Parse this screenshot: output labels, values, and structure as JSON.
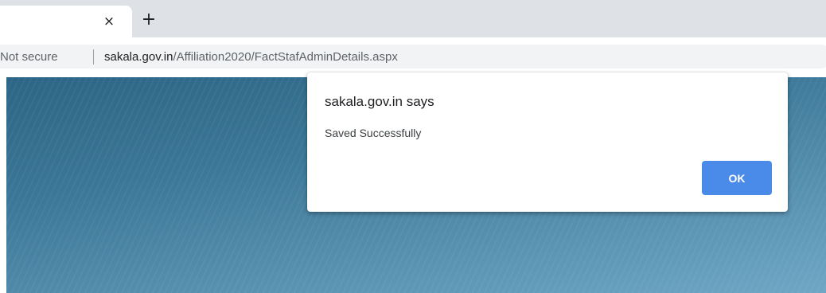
{
  "browser": {
    "tab": {
      "close_glyph": "×",
      "close_icon": "close-icon"
    },
    "new_tab_glyph": "+",
    "new_tab_icon": "plus-icon",
    "omnibox": {
      "security_label": "Not secure",
      "url_host": "sakala.gov.in",
      "url_path": "/Affiliation2020/FactStafAdminDetails.aspx"
    }
  },
  "dialog": {
    "title": "sakala.gov.in says",
    "message": "Saved Successfully",
    "ok_label": "OK",
    "ok_color": "#4a8ae8"
  }
}
